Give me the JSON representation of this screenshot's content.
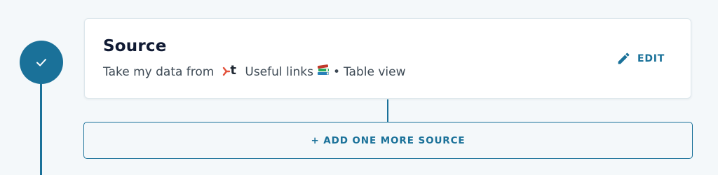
{
  "source_card": {
    "title": "Source",
    "description_prefix": "Take my data from",
    "tool_logo_letter": "t",
    "source_name": "Useful links",
    "separator": "•",
    "view_name": "Table view",
    "edit_label": "EDIT"
  },
  "add_source_label": "+ ADD ONE MORE SOURCE",
  "icons": {
    "step_status": "checkmark-icon",
    "edit": "pencil-icon",
    "source_tool": "tool-logo-icon",
    "books": "books-emoji"
  },
  "colors": {
    "accent": "#1a7199",
    "background": "#f4f8fa",
    "card": "#ffffff",
    "title": "#101a33",
    "tool_mark": "#e2503a"
  }
}
